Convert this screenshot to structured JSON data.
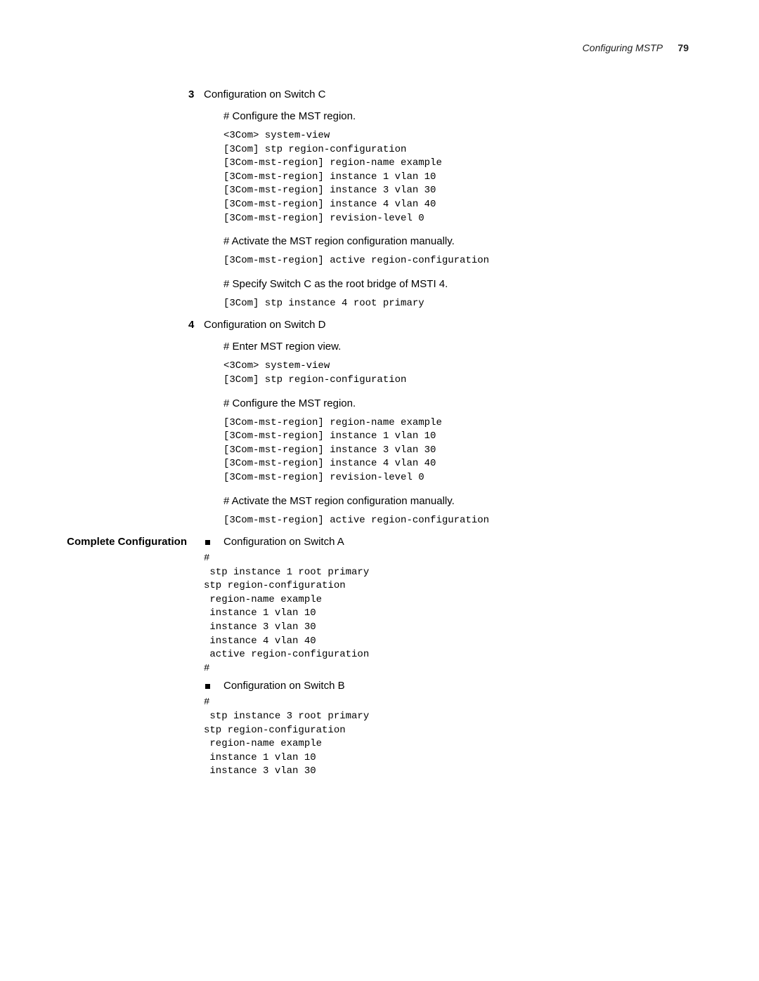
{
  "header": {
    "title": "Configuring MSTP",
    "page": "79"
  },
  "section3": {
    "num": "3",
    "title": "Configuration on Switch C",
    "p1": "# Configure the MST region.",
    "code1": "<3Com> system-view\n[3Com] stp region-configuration\n[3Com-mst-region] region-name example\n[3Com-mst-region] instance 1 vlan 10\n[3Com-mst-region] instance 3 vlan 30\n[3Com-mst-region] instance 4 vlan 40\n[3Com-mst-region] revision-level 0",
    "p2": "# Activate the MST region configuration manually.",
    "code2": "[3Com-mst-region] active region-configuration",
    "p3": "# Specify Switch C as the root bridge of MSTI 4.",
    "code3": "[3Com] stp instance 4 root primary"
  },
  "section4": {
    "num": "4",
    "title": "Configuration on Switch D",
    "p1": "# Enter MST region view.",
    "code1": "<3Com> system-view\n[3Com] stp region-configuration",
    "p2": "# Configure the MST region.",
    "code2": "[3Com-mst-region] region-name example\n[3Com-mst-region] instance 1 vlan 10\n[3Com-mst-region] instance 3 vlan 30\n[3Com-mst-region] instance 4 vlan 40\n[3Com-mst-region] revision-level 0",
    "p3": "# Activate the MST region configuration manually.",
    "code3": "[3Com-mst-region] active region-configuration"
  },
  "complete": {
    "side_label": "Complete Configuration",
    "itemA": {
      "title": "Configuration on Switch A",
      "code": "#\n stp instance 1 root primary\nstp region-configuration\n region-name example\n instance 1 vlan 10\n instance 3 vlan 30\n instance 4 vlan 40\n active region-configuration\n#"
    },
    "itemB": {
      "title": "Configuration on Switch B",
      "code": "#\n stp instance 3 root primary\nstp region-configuration\n region-name example\n instance 1 vlan 10\n instance 3 vlan 30"
    }
  }
}
